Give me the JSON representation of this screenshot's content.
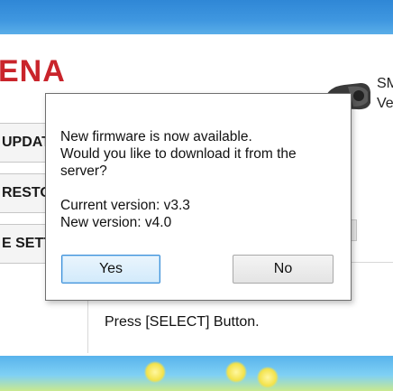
{
  "app": {
    "logo_text": "ENA",
    "device_label_1": "SM",
    "device_label_2": "Ve",
    "side_buttons": [
      "UPDATE",
      "RESTORE",
      "E SETT"
    ],
    "instruction": "Press [SELECT] Button."
  },
  "dialog": {
    "message_line1": "New firmware is now available.",
    "message_line2": "Would you like to download it from the",
    "message_line3": "server?",
    "current_version": "Current version: v3.3",
    "new_version": "New version: v4.0",
    "yes_label": "Yes",
    "no_label": "No"
  },
  "colors": {
    "logo": "#c9242b",
    "desktop": "#3f97e0",
    "focus_button_border": "#3c8fd8"
  }
}
